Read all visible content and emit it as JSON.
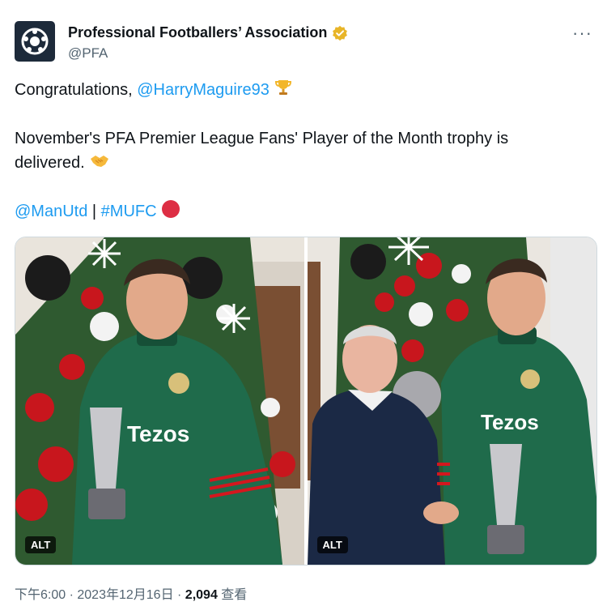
{
  "author": {
    "display_name": "Professional Footballers’ Association",
    "handle": "@PFA",
    "avatar_icon": "pfa-logo-icon",
    "verified_icon": "gold-verified-badge-icon"
  },
  "more_label": "···",
  "tweet": {
    "line1_prefix": "Congratulations, ",
    "mention_maguire": "@HarryMaguire93",
    "line2": "November's PFA Premier League Fans' Player of the Month trophy is delivered.",
    "mention_manutd": "@ManUtd",
    "separator": " | ",
    "hashtag": "#MUFC"
  },
  "media": {
    "alt_label_1": "ALT",
    "alt_label_2": "ALT",
    "shirt_sponsor_1": "Tezos",
    "shirt_sponsor_2": "Tezos"
  },
  "meta": {
    "time": "下午6:00",
    "dot": " · ",
    "date": "2023年12月16日",
    "views_count": "2,094",
    "views_label": " 查看"
  },
  "colors": {
    "link": "#1d9bf0",
    "jersey": "#1f6b4b",
    "badge_gold": "#e8b528"
  }
}
